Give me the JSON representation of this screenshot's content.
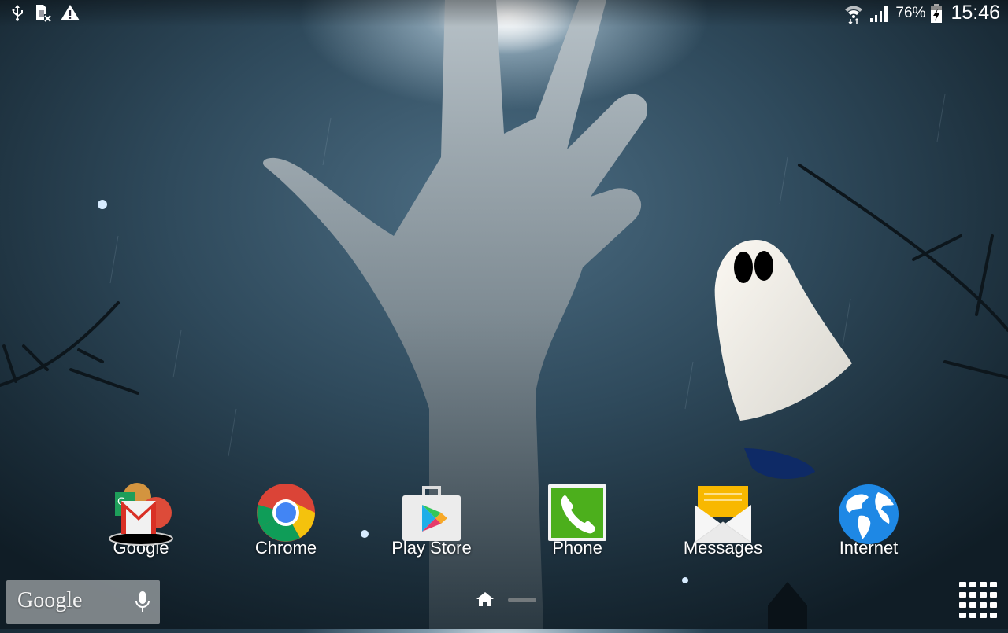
{
  "status_bar": {
    "left_icons": [
      "usb-icon",
      "sim-card-missing-icon",
      "warning-icon"
    ],
    "right_icons": [
      "wifi-icon",
      "signal-icon",
      "battery-charging-icon"
    ],
    "battery_percent": "76%",
    "time": "15:46"
  },
  "wallpaper": {
    "theme": "Halloween zombie hand with ghost"
  },
  "dock": {
    "items": [
      {
        "label": "Google",
        "icon": "google-folder-icon"
      },
      {
        "label": "Chrome",
        "icon": "chrome-icon"
      },
      {
        "label": "Play Store",
        "icon": "play-store-icon"
      },
      {
        "label": "Phone",
        "icon": "phone-icon"
      },
      {
        "label": "Messages",
        "icon": "messages-icon"
      },
      {
        "label": "Internet",
        "icon": "internet-globe-icon"
      }
    ]
  },
  "search_widget": {
    "logo_text": "Google",
    "mic_icon": "microphone-icon"
  },
  "navigation": {
    "home_icon": "home-icon",
    "apps_icon": "apps-grid-icon"
  },
  "colors": {
    "gmail_red": "#d93025",
    "chrome_blue": "#4285f4",
    "phone_green": "#4caf1c",
    "messages_yellow": "#f8b800",
    "globe_blue": "#1e88e5"
  }
}
